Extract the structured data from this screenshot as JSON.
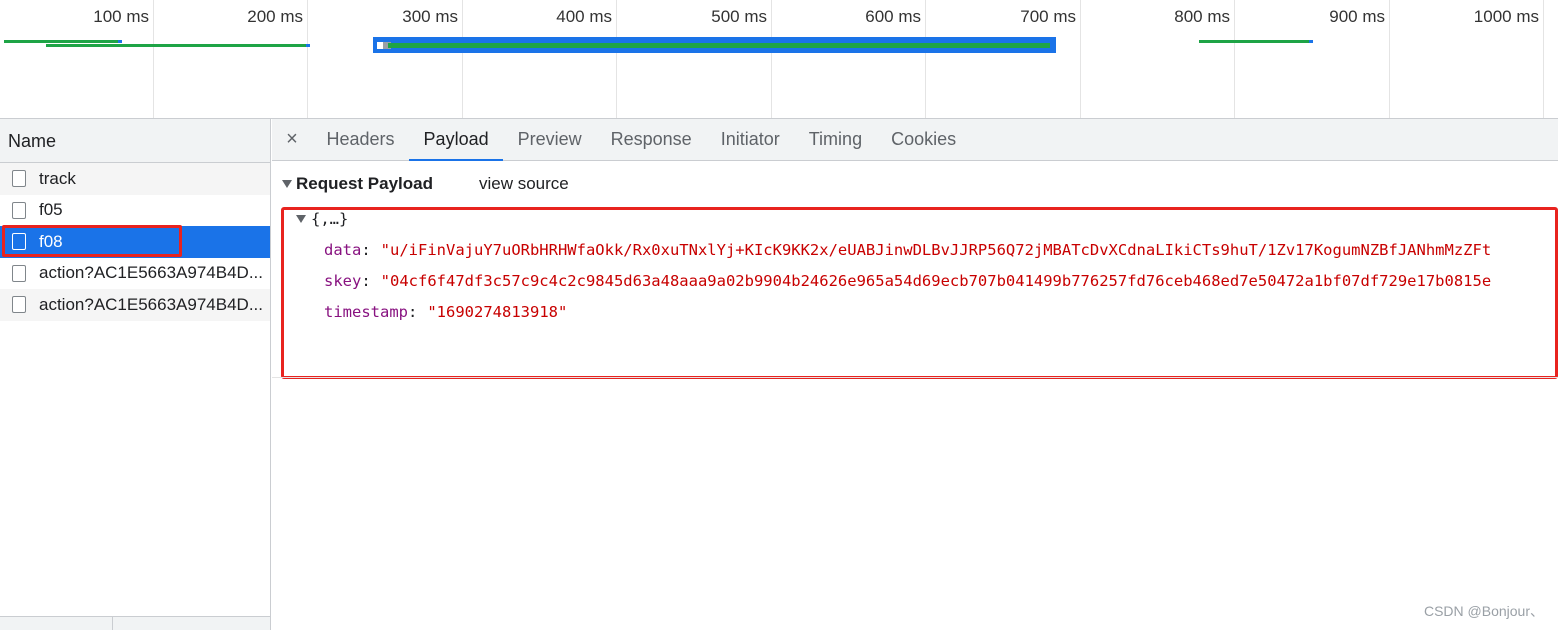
{
  "timeline": {
    "ticks": [
      "100 ms",
      "200 ms",
      "300 ms",
      "400 ms",
      "500 ms",
      "600 ms",
      "700 ms",
      "800 ms",
      "900 ms",
      "1000 ms"
    ]
  },
  "request_list": {
    "header": "Name",
    "rows": [
      {
        "label": "track"
      },
      {
        "label": "f05"
      },
      {
        "label": "f08"
      },
      {
        "label": "action?AC1E5663A974B4D..."
      },
      {
        "label": "action?AC1E5663A974B4D..."
      }
    ]
  },
  "details": {
    "close_glyph": "×",
    "tabs": [
      "Headers",
      "Payload",
      "Preview",
      "Response",
      "Initiator",
      "Timing",
      "Cookies"
    ],
    "active_tab": "Payload",
    "payload": {
      "title": "Request Payload",
      "view_source": "view source",
      "root": "{,…}",
      "props": [
        {
          "key": "data",
          "value": "\"u/iFinVajuY7uORbHRHWfaOkk/Rx0xuTNxlYj+KIcK9KK2x/eUABJinwDLBvJJRP56Q72jMBATcDvXCdnaLIkiCTs9huT/1Zv17KogumNZBfJANhmMzZFt"
        },
        {
          "key": "skey",
          "value": "\"04cf6f47df3c57c9c4c2c9845d63a48aaa9a02b9904b24626e965a54d69ecb707b041499b776257fd76ceb468ed7e50472a1bf07df729e17b0815e"
        },
        {
          "key": "timestamp",
          "value": "\"1690274813918\""
        }
      ]
    }
  },
  "watermark": "CSDN @Bonjour、",
  "colors": {
    "accent": "#1a73e8",
    "highlight": "#e8231f",
    "bar_green": "#1ea446",
    "key_purple": "#881280",
    "string_red": "#c80000"
  }
}
